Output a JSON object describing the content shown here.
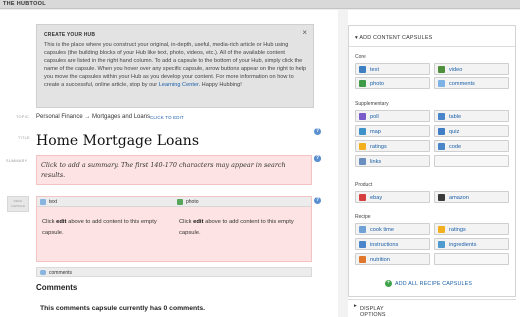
{
  "app": {
    "title": "THE HUBTOOL"
  },
  "create_hub": {
    "heading": "CREATE YOUR HUB",
    "close_glyph": "×",
    "body_text": "This is the place where you construct your original, in-depth, useful, media-rich article or Hub using capsules (the building blocks of your Hub like text, photo, videos, etc.). All of the available content capsules are listed in the right hand column. To add a capsule to the bottom of your Hub, simply click the name of the capsule. When you hover over any specific capsule, arrow buttons appear on the right to help you move the capsules within your Hub as you develop your content. For more information on how to create a successful, online article, stop by our ",
    "link_text": "Learning Center",
    "body_tail": ". Happy Hubbing!"
  },
  "labels": {
    "topic": "TOPIC",
    "title": "TITLE",
    "summary": "SUMMARY",
    "drag": "DRAG CAPSULE"
  },
  "topic": {
    "value": "Personal Finance → Mortgages and Loans",
    "edit": "CLICK TO EDIT"
  },
  "hub_title": "Home Mortgage Loans",
  "summary": {
    "placeholder": "Click to add a summary. The first 140-170 characters may appear in search results."
  },
  "capsules": [
    {
      "name": "text",
      "prompt_pre": "Click ",
      "prompt_edit": "edit",
      "prompt_post": " above to add content to this empty capsule.",
      "color": "#8ab4e0"
    },
    {
      "name": "photo",
      "prompt_pre": "Click ",
      "prompt_edit": "edit",
      "prompt_post": " above to add content to this empty capsule.",
      "color": "#5aa55e"
    }
  ],
  "comments": {
    "capsule_label": "comments",
    "title": "Comments",
    "message": "This comments capsule currently has 0 comments."
  },
  "panel": {
    "title": "ADD CONTENT CAPSULES",
    "sections": {
      "core": "Core",
      "supplementary": "Supplementary",
      "product": "Product",
      "recipe": "Recipe"
    },
    "core": [
      {
        "label": "text",
        "icon": "text-icon",
        "color": "#3e7fc1"
      },
      {
        "label": "video",
        "icon": "video-icon",
        "color": "#4d8f3a"
      },
      {
        "label": "photo",
        "icon": "photo-icon",
        "color": "#3f9b48"
      },
      {
        "label": "comments",
        "icon": "comments-icon",
        "color": "#7fb2e4"
      }
    ],
    "supplementary": [
      {
        "label": "poll",
        "icon": "poll-icon",
        "color": "#7a5bc9"
      },
      {
        "label": "table",
        "icon": "table-icon",
        "color": "#4a85c9"
      },
      {
        "label": "map",
        "icon": "map-icon",
        "color": "#3f92c9"
      },
      {
        "label": "quiz",
        "icon": "quiz-icon",
        "color": "#3f7dc4"
      },
      {
        "label": "ratings",
        "icon": "ratings-icon",
        "color": "#f2b01e"
      },
      {
        "label": "code",
        "icon": "code-icon",
        "color": "#4a86c9"
      },
      {
        "label": "links",
        "icon": "links-icon",
        "color": "#6a8fbf"
      }
    ],
    "product": [
      {
        "label": "ebay",
        "icon": "ebay-icon",
        "color": "#d53f3f"
      },
      {
        "label": "amazon",
        "icon": "amazon-icon",
        "color": "#3a3a3a"
      }
    ],
    "recipe": [
      {
        "label": "cook time",
        "icon": "cook-time-icon",
        "color": "#6fa0d6"
      },
      {
        "label": "ratings",
        "icon": "recipe-ratings-icon",
        "color": "#f2b01e"
      },
      {
        "label": "instructions",
        "icon": "instructions-icon",
        "color": "#4a86c9"
      },
      {
        "label": "ingredients",
        "icon": "ingredients-icon",
        "color": "#4f9bd0"
      },
      {
        "label": "nutrition",
        "icon": "nutrition-icon",
        "color": "#e0772a"
      }
    ],
    "add_all": "ADD ALL RECIPE CAPSULES",
    "display_options": "DISPLAY OPTIONS"
  }
}
